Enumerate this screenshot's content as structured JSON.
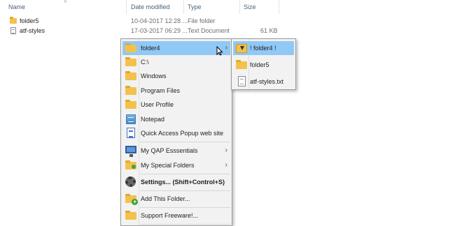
{
  "explorer": {
    "columns": {
      "name": "Name",
      "date": "Date modified",
      "type": "Type",
      "size": "Size"
    },
    "files": [
      {
        "name": "folder5",
        "date": "10-04-2017 12:28 ...",
        "type": "File folder",
        "size": "",
        "icon": "folder-icon"
      },
      {
        "name": "atf-styles",
        "date": "17-03-2017 06:29 ...",
        "type": "Text Document",
        "size": "61 KB",
        "icon": "text-file-icon"
      }
    ]
  },
  "popup_menu": {
    "items": [
      {
        "label": "folder4",
        "icon": "folder-icon",
        "submenu": true,
        "highlighted": true
      },
      {
        "label": "C:\\",
        "icon": "folder-icon"
      },
      {
        "label": "Windows",
        "icon": "folder-icon"
      },
      {
        "label": "Program Files",
        "icon": "folder-icon"
      },
      {
        "label": "User Profile",
        "icon": "folder-icon"
      },
      {
        "label": "Notepad",
        "icon": "notepad-icon"
      },
      {
        "label": "Quick Access Popup web site",
        "icon": "web-page-icon"
      },
      {
        "label": "My QAP Esssentials",
        "icon": "monitor-icon",
        "submenu": true
      },
      {
        "label": "My Special Folders",
        "icon": "special-folder-icon",
        "submenu": true
      },
      {
        "label": "Settings... (Shift+Control+S)",
        "icon": "gear-icon",
        "bold": true
      },
      {
        "label": "Add This Folder...",
        "icon": "add-folder-icon"
      },
      {
        "label": "Support Freeware!...",
        "icon": "folder-icon"
      }
    ]
  },
  "submenu": {
    "items": [
      {
        "label": "! folder4 !",
        "icon": "download-folder-icon",
        "highlighted": true
      },
      {
        "label": "folder5",
        "icon": "folder-icon"
      },
      {
        "label": "atf-styles.txt",
        "icon": "text-file-icon"
      }
    ]
  },
  "colors": {
    "highlight": "#90c8f6",
    "menu_background": "#f2f2f2",
    "folder": "#f3c14c"
  }
}
